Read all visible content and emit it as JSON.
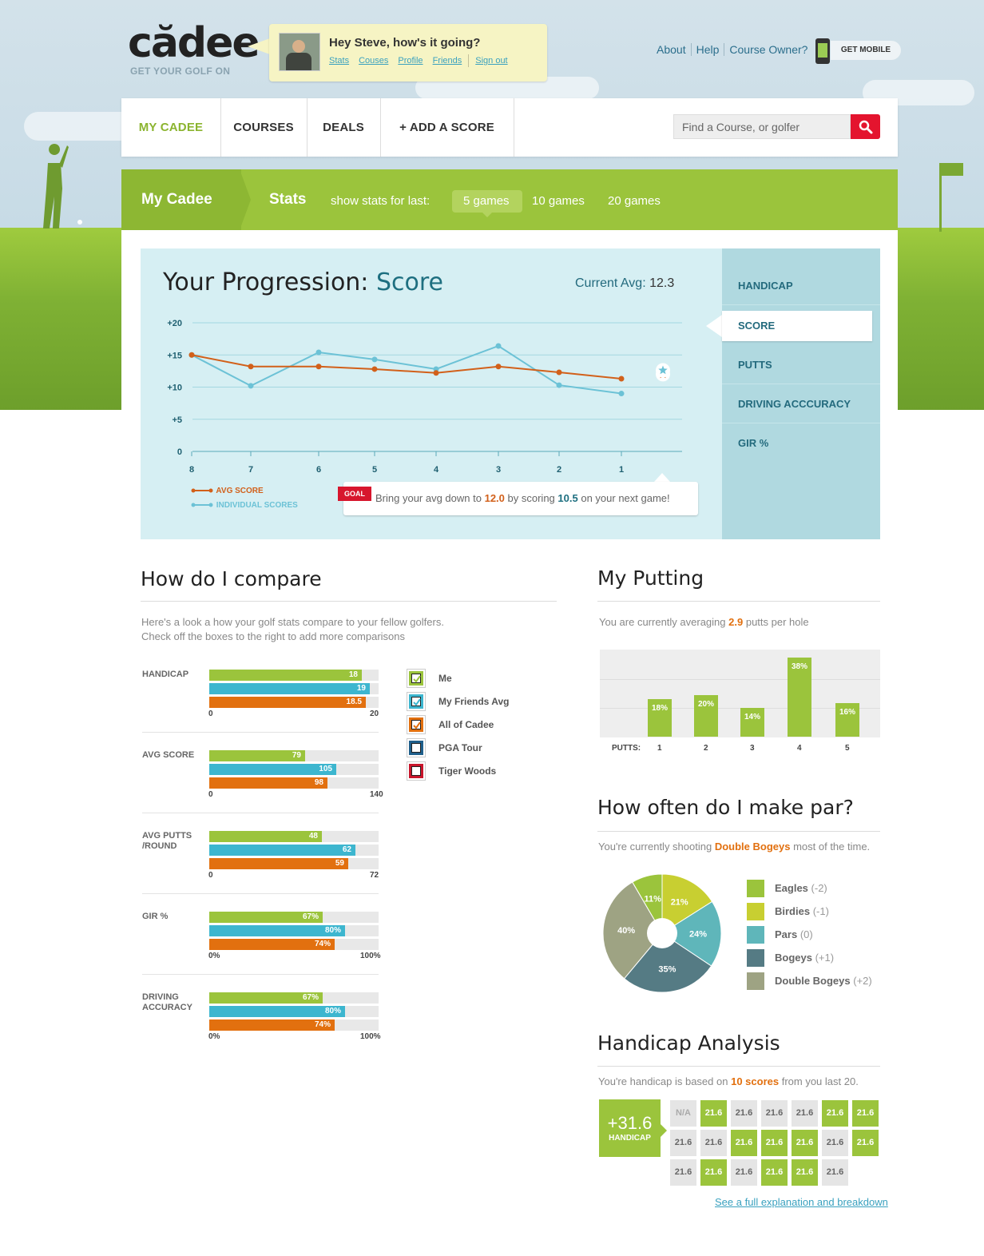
{
  "brand": {
    "logo": "cădee",
    "tagline": "GET YOUR GOLF ON"
  },
  "greeting": {
    "text": "Hey Steve, how's it going?",
    "links": [
      "Stats",
      "Couses",
      "Profile",
      "Friends",
      "Sign out"
    ]
  },
  "top_links": [
    "About",
    "Help",
    "Course Owner?"
  ],
  "get_mobile": "GET MOBILE",
  "nav": {
    "items": [
      "MY CADEE",
      "COURSES",
      "DEALS",
      "+ ADD A SCORE"
    ],
    "search_placeholder": "Find a Course, or golfer"
  },
  "stats_bar": {
    "section": "My Cadee",
    "page": "Stats",
    "prompt": "show stats for last:",
    "options": [
      "5 games",
      "10 games",
      "20 games"
    ],
    "selected": "5 games"
  },
  "progression": {
    "title_prefix": "Your Progression:",
    "title_metric": "Score",
    "current_avg_label": "Current Avg:",
    "current_avg": "12.3",
    "menu": [
      "HANDICAP",
      "SCORE",
      "PUTTS",
      "DRIVING ACCCURACY",
      "GIR %"
    ],
    "active_menu": "SCORE",
    "legend": [
      "AVG SCORE",
      "INDIVIDUAL SCORES"
    ],
    "goal": {
      "badge": "GOAL",
      "text_a": "Bring your avg down to",
      "target_avg": "12.0",
      "text_b": "by scoring",
      "target_score": "10.5",
      "text_c": "on your next game!"
    }
  },
  "chart_data": [
    {
      "type": "line",
      "x": [
        "8",
        "7",
        "6",
        "5",
        "4",
        "3",
        "2",
        "1"
      ],
      "yticks": [
        "0",
        "+5",
        "+10",
        "+15",
        "+20"
      ],
      "ylim": [
        0,
        20
      ],
      "series": [
        {
          "name": "AVG SCORE",
          "color": "#d2601a",
          "values": [
            15.0,
            13.2,
            13.2,
            12.8,
            12.2,
            13.2,
            12.3,
            11.3
          ]
        },
        {
          "name": "INDIVIDUAL SCORES",
          "color": "#6cc2d6",
          "values": [
            15.0,
            10.2,
            15.4,
            14.3,
            12.8,
            16.4,
            10.3,
            9.0
          ]
        }
      ],
      "next_game_markers": {
        "avg_goal": 12.0,
        "score_goal": 10.5
      }
    },
    {
      "type": "bar",
      "title": "My Putting",
      "xlabel": "PUTTS:",
      "categories": [
        "1",
        "2",
        "3",
        "4",
        "5"
      ],
      "values": [
        18,
        20,
        14,
        38,
        16
      ],
      "labels": [
        "18%",
        "20%",
        "14%",
        "38%",
        "16%"
      ],
      "ylim": [
        0,
        40
      ]
    },
    {
      "type": "pie",
      "title": "How often do I make par?",
      "categories": [
        "Eagles",
        "Birdies",
        "Pars",
        "Bogeys",
        "Double Bogeys"
      ],
      "values": [
        0,
        11,
        21,
        24,
        35,
        40
      ],
      "slices": [
        {
          "label": "11%",
          "value": 11,
          "color": "#9bc43c"
        },
        {
          "label": "21%",
          "value": 21,
          "color": "#c8cf31"
        },
        {
          "label": "24%",
          "value": 24,
          "color": "#5fb6ba"
        },
        {
          "label": "35%",
          "value": 35,
          "color": "#557b84"
        },
        {
          "label": "40%",
          "value": 40,
          "color": "#9ea383"
        }
      ]
    }
  ],
  "compare": {
    "title": "How do I compare",
    "desc_1": "Here's a look a how your golf stats compare to your fellow golfers.",
    "desc_2": "Check off the boxes to the right to add more comparisons",
    "groups": [
      {
        "label": "HANDICAP",
        "values": [
          18,
          19,
          18.5
        ],
        "labels": [
          "18",
          "19",
          "18.5"
        ],
        "min": "0",
        "max": "20",
        "scale": 20
      },
      {
        "label": "AVG SCORE",
        "values": [
          79,
          105,
          98
        ],
        "labels": [
          "79",
          "105",
          "98"
        ],
        "min": "0",
        "max": "140",
        "scale": 140
      },
      {
        "label": "AVG PUTTS /ROUND",
        "values": [
          48,
          62,
          59
        ],
        "labels": [
          "48",
          "62",
          "59"
        ],
        "min": "0",
        "max": "72",
        "scale": 72
      },
      {
        "label": "GIR %",
        "values": [
          67,
          80,
          74
        ],
        "labels": [
          "67%",
          "80%",
          "74%"
        ],
        "min": "0%",
        "max": "100%",
        "scale": 100
      },
      {
        "label": "DRIVING ACCURACY",
        "values": [
          67,
          80,
          74
        ],
        "labels": [
          "67%",
          "80%",
          "74%"
        ],
        "min": "0%",
        "max": "100%",
        "scale": 100
      }
    ],
    "series_colors": [
      "#9bc43c",
      "#3db6cf",
      "#e2700f"
    ],
    "checkboxes": [
      {
        "label": "Me",
        "color": "#9bc43c",
        "checked": true
      },
      {
        "label": "My Friends Avg",
        "color": "#3db6cf",
        "checked": true
      },
      {
        "label": "All of Cadee",
        "color": "#e2700f",
        "checked": true
      },
      {
        "label": "PGA Tour",
        "color": "#1f5f8b",
        "checked": false
      },
      {
        "label": "Tiger Woods",
        "color": "#c8152b",
        "checked": false
      }
    ]
  },
  "putting": {
    "title": "My Putting",
    "desc_a": "You are currently averaging",
    "value": "2.9",
    "desc_b": "putts per hole"
  },
  "par": {
    "title": "How often do I make par?",
    "desc_a": "You're currently shooting",
    "value": "Double Bogeys",
    "desc_b": "most of the time.",
    "legend": [
      {
        "name": "Eagles",
        "delta": "(-2)",
        "color": "#9bc43c"
      },
      {
        "name": "Birdies",
        "delta": "(-1)",
        "color": "#c8cf31"
      },
      {
        "name": "Pars",
        "delta": "(0)",
        "color": "#5fb6ba"
      },
      {
        "name": "Bogeys",
        "delta": "(+1)",
        "color": "#557b84"
      },
      {
        "name": "Double Bogeys",
        "delta": "(+2)",
        "color": "#9ea383"
      }
    ]
  },
  "handicap": {
    "title": "Handicap Analysis",
    "desc_a": "You're handicap is based on",
    "value": "10 scores",
    "desc_b": "from you last 20.",
    "big": "+31.6",
    "big_label": "HANDICAP",
    "cells": [
      {
        "v": "N/A",
        "s": "na"
      },
      {
        "v": "21.6",
        "s": "g"
      },
      {
        "v": "21.6",
        "s": "n"
      },
      {
        "v": "21.6",
        "s": "n"
      },
      {
        "v": "21.6",
        "s": "n"
      },
      {
        "v": "21.6",
        "s": "g"
      },
      {
        "v": "21.6",
        "s": "g"
      },
      {
        "v": "21.6",
        "s": "n"
      },
      {
        "v": "21.6",
        "s": "n"
      },
      {
        "v": "21.6",
        "s": "g"
      },
      {
        "v": "21.6",
        "s": "g"
      },
      {
        "v": "21.6",
        "s": "g"
      },
      {
        "v": "21.6",
        "s": "n"
      },
      {
        "v": "21.6",
        "s": "g"
      },
      {
        "v": "21.6",
        "s": "n"
      },
      {
        "v": "21.6",
        "s": "g"
      },
      {
        "v": "21.6",
        "s": "n"
      },
      {
        "v": "21.6",
        "s": "g"
      },
      {
        "v": "21.6",
        "s": "g"
      },
      {
        "v": "21.6",
        "s": "n"
      }
    ],
    "link": "See a full explanation and breakdown"
  }
}
